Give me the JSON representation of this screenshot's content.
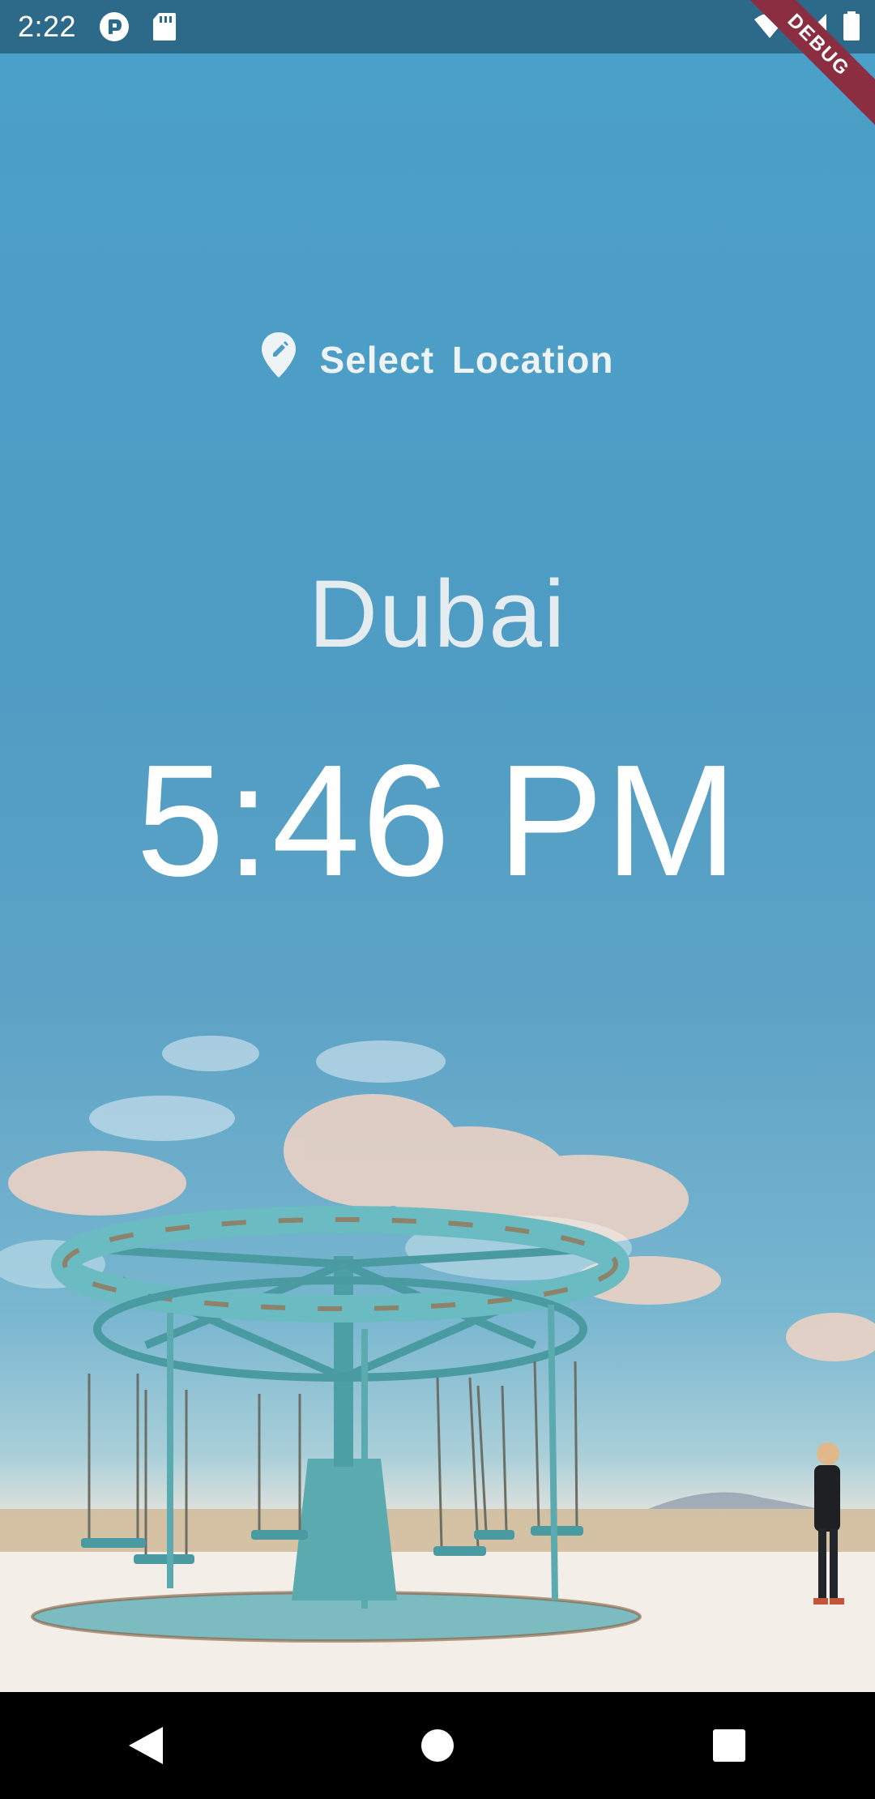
{
  "status_bar": {
    "time": "2:22",
    "left_icons": [
      "pocket-casts-icon",
      "sd-card-icon"
    ],
    "right_icons": [
      "wifi-icon",
      "signal-icon",
      "battery-icon"
    ],
    "debug_label": "DEBUG"
  },
  "main": {
    "select_location_label": "Select  Location",
    "select_location_icon": "edit-location-icon",
    "location": "Dubai",
    "time": "5:46 PM",
    "text_color": "#ffffff"
  },
  "nav_bar": {
    "buttons": [
      "back-icon",
      "home-icon",
      "recents-icon"
    ]
  },
  "colors": {
    "sky": "#4aa0c8",
    "status_bar": "#285f7d",
    "debug_ribbon": "#8b2e42"
  }
}
